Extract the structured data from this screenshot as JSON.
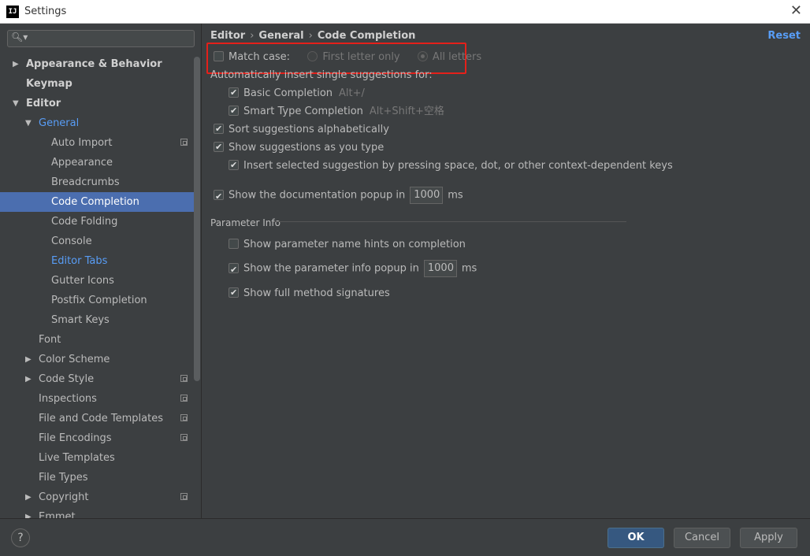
{
  "window": {
    "title": "Settings",
    "app_icon_text": "IJ"
  },
  "search": {
    "value": "",
    "placeholder": ""
  },
  "tree": [
    {
      "label": "Appearance & Behavior",
      "arrow": "▶",
      "bold": true
    },
    {
      "label": "Keymap",
      "bold": true
    },
    {
      "label": "Editor",
      "arrow": "▼",
      "bold": true
    },
    {
      "label": "General",
      "arrow": "▼",
      "blue": true
    },
    {
      "label": "Auto Import",
      "proj": true
    },
    {
      "label": "Appearance"
    },
    {
      "label": "Breadcrumbs"
    },
    {
      "label": "Code Completion",
      "selected": true
    },
    {
      "label": "Code Folding"
    },
    {
      "label": "Console"
    },
    {
      "label": "Editor Tabs",
      "blue": true
    },
    {
      "label": "Gutter Icons"
    },
    {
      "label": "Postfix Completion"
    },
    {
      "label": "Smart Keys"
    },
    {
      "label": "Font"
    },
    {
      "label": "Color Scheme",
      "arrow": "▶"
    },
    {
      "label": "Code Style",
      "arrow": "▶",
      "proj": true
    },
    {
      "label": "Inspections",
      "proj": true
    },
    {
      "label": "File and Code Templates",
      "proj": true
    },
    {
      "label": "File Encodings",
      "proj": true
    },
    {
      "label": "Live Templates"
    },
    {
      "label": "File Types"
    },
    {
      "label": "Copyright",
      "arrow": "▶",
      "proj": true
    },
    {
      "label": "Emmet",
      "arrow": "▶"
    }
  ],
  "breadcrumb": [
    "Editor",
    "General",
    "Code Completion"
  ],
  "reset_label": "Reset",
  "match_case": {
    "label": "Match case:",
    "checked": false,
    "option1": "First letter only",
    "option2": "All letters"
  },
  "auto_insert_label": "Automatically insert single suggestions for:",
  "basic_completion": {
    "label": "Basic Completion",
    "hint": "Alt+/",
    "checked": true
  },
  "smart_completion": {
    "label": "Smart Type Completion",
    "hint": "Alt+Shift+空格",
    "checked": true
  },
  "sort_alpha": {
    "label": "Sort suggestions alphabetically",
    "checked": true
  },
  "show_as_type": {
    "label": "Show suggestions as you type",
    "checked": true
  },
  "insert_selected": {
    "label": "Insert selected suggestion by pressing space, dot, or other context-dependent keys",
    "checked": true
  },
  "doc_popup": {
    "label": "Show the documentation popup in",
    "value": "1000",
    "unit": "ms",
    "checked": true
  },
  "param_info": {
    "title": "Parameter Info",
    "name_hints": {
      "label": "Show parameter name hints on completion",
      "checked": false
    },
    "info_popup": {
      "label": "Show the parameter info popup in",
      "value": "1000",
      "unit": "ms",
      "checked": true
    },
    "full_signatures": {
      "label": "Show full method signatures",
      "checked": true
    }
  },
  "buttons": {
    "help": "?",
    "ok": "OK",
    "cancel": "Cancel",
    "apply": "Apply"
  }
}
